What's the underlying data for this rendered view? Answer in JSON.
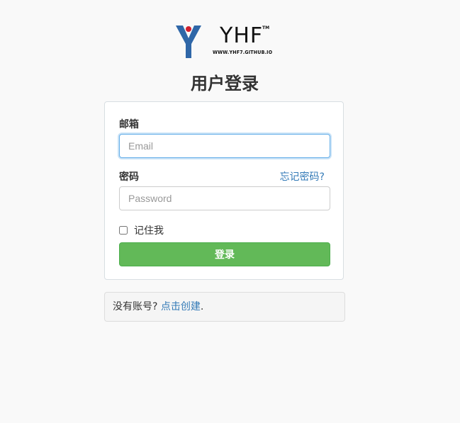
{
  "logo": {
    "name": "YHF",
    "trademark": "TM",
    "url": "WWW.YHF7.GITHUB.IO"
  },
  "page_title": "用户登录",
  "form": {
    "email_label": "邮箱",
    "email_placeholder": "Email",
    "password_label": "密码",
    "forgot_link": "忘记密码?",
    "password_placeholder": "Password",
    "remember_label": "记住我",
    "remember_checked": false,
    "submit_label": "登录"
  },
  "signup": {
    "prompt": "没有账号? ",
    "link": "点击创建",
    "suffix": "."
  },
  "colors": {
    "logo_blue": "#2f67a8",
    "logo_red": "#d0202e",
    "primary_button": "#62b958",
    "link": "#337ab7",
    "focus_border": "#66afe9"
  }
}
